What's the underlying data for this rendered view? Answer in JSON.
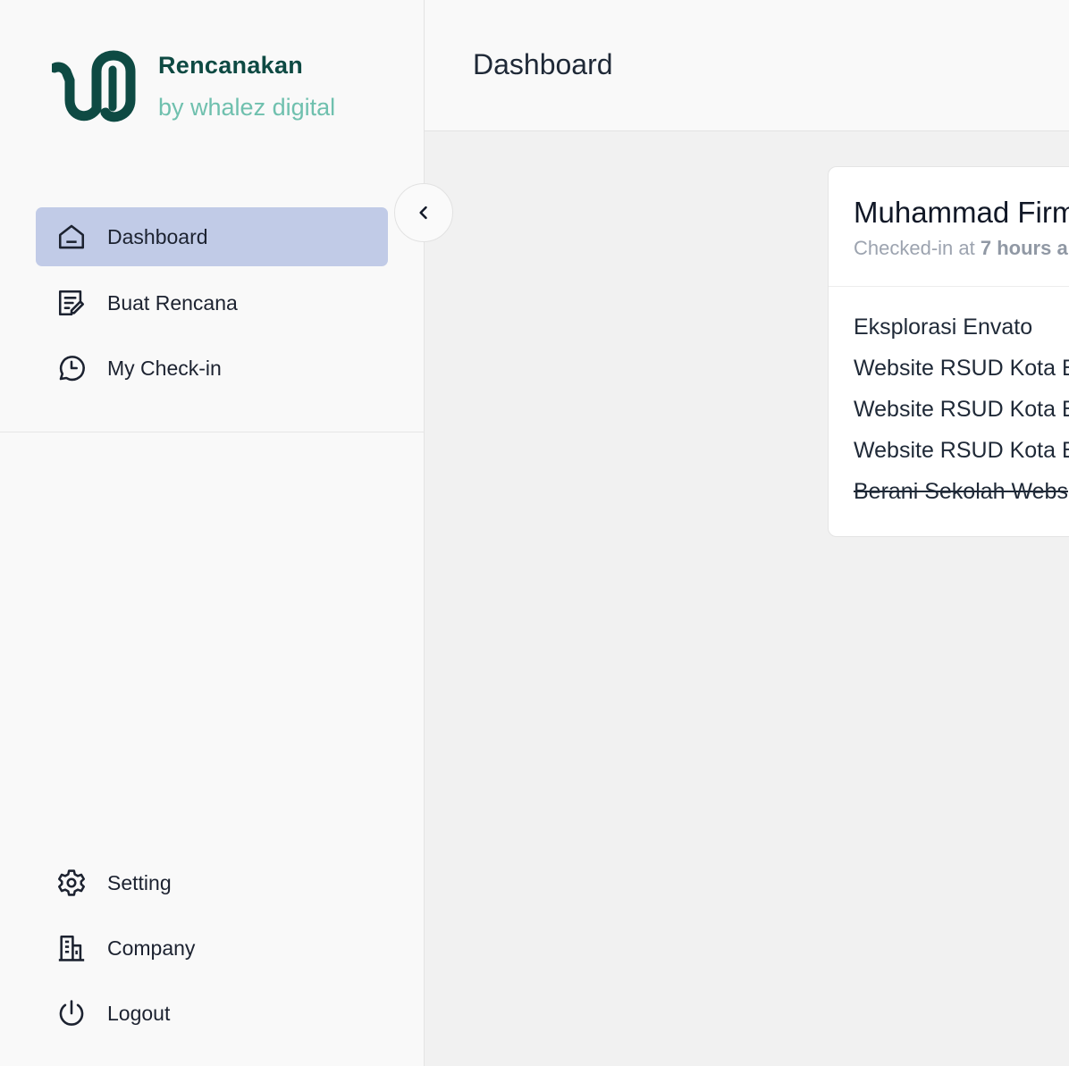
{
  "brand": {
    "name": "Rencanakan",
    "subtitle": "by whalez digital",
    "primary_color": "#0e4a43",
    "accent_color": "#6fc0ae"
  },
  "sidebar": {
    "active_color": "#c1cbe7",
    "items": [
      {
        "label": "Dashboard",
        "icon": "home-icon",
        "active": true
      },
      {
        "label": "Buat Rencana",
        "icon": "edit-note-icon",
        "active": false
      },
      {
        "label": "My Check-in",
        "icon": "clock-icon",
        "active": false
      }
    ],
    "bottom_items": [
      {
        "label": "Setting",
        "icon": "gear-icon"
      },
      {
        "label": "Company",
        "icon": "building-icon"
      },
      {
        "label": "Logout",
        "icon": "power-icon"
      }
    ],
    "collapse_icon": "chevron-left-icon"
  },
  "header": {
    "title": "Dashboard"
  },
  "checkin_card": {
    "name": "Muhammad Firm",
    "meta_prefix": "Checked-in at",
    "meta_time": "7 hours a",
    "plans": [
      {
        "text": "Eksplorasi Envato",
        "done": false
      },
      {
        "text": "Website RSUD Kota B",
        "done": false
      },
      {
        "text": "Website RSUD Kota B",
        "done": false
      },
      {
        "text": "Website RSUD Kota B",
        "done": false
      },
      {
        "text": "Berani Sekolah Webs",
        "done": true
      }
    ]
  }
}
